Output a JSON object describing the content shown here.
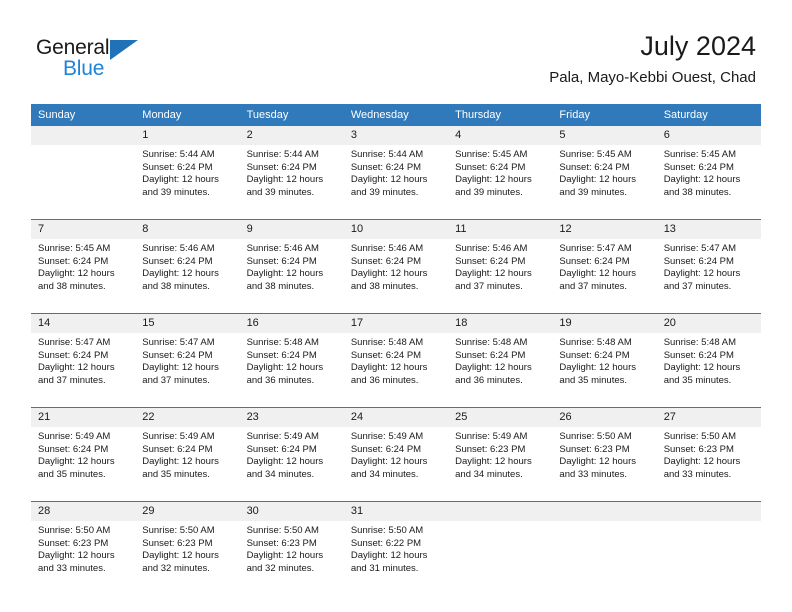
{
  "brand": {
    "name_top": "General",
    "name_bottom": "Blue",
    "accent_color": "#1f84d6",
    "triangle_color": "#1f72b8"
  },
  "header": {
    "title": "July 2024",
    "subtitle": "Pala, Mayo-Kebbi Ouest, Chad"
  },
  "calendar": {
    "header_color": "#3079bb",
    "daynum_bg": "#f0f0f0",
    "weekdays": [
      "Sunday",
      "Monday",
      "Tuesday",
      "Wednesday",
      "Thursday",
      "Friday",
      "Saturday"
    ],
    "weeks": [
      [
        {
          "day": "",
          "sunrise": "",
          "sunset": "",
          "daylight": "",
          "blank": true
        },
        {
          "day": "1",
          "sunrise": "Sunrise: 5:44 AM",
          "sunset": "Sunset: 6:24 PM",
          "daylight": "Daylight: 12 hours and 39 minutes."
        },
        {
          "day": "2",
          "sunrise": "Sunrise: 5:44 AM",
          "sunset": "Sunset: 6:24 PM",
          "daylight": "Daylight: 12 hours and 39 minutes."
        },
        {
          "day": "3",
          "sunrise": "Sunrise: 5:44 AM",
          "sunset": "Sunset: 6:24 PM",
          "daylight": "Daylight: 12 hours and 39 minutes."
        },
        {
          "day": "4",
          "sunrise": "Sunrise: 5:45 AM",
          "sunset": "Sunset: 6:24 PM",
          "daylight": "Daylight: 12 hours and 39 minutes."
        },
        {
          "day": "5",
          "sunrise": "Sunrise: 5:45 AM",
          "sunset": "Sunset: 6:24 PM",
          "daylight": "Daylight: 12 hours and 39 minutes."
        },
        {
          "day": "6",
          "sunrise": "Sunrise: 5:45 AM",
          "sunset": "Sunset: 6:24 PM",
          "daylight": "Daylight: 12 hours and 38 minutes."
        }
      ],
      [
        {
          "day": "7",
          "sunrise": "Sunrise: 5:45 AM",
          "sunset": "Sunset: 6:24 PM",
          "daylight": "Daylight: 12 hours and 38 minutes."
        },
        {
          "day": "8",
          "sunrise": "Sunrise: 5:46 AM",
          "sunset": "Sunset: 6:24 PM",
          "daylight": "Daylight: 12 hours and 38 minutes."
        },
        {
          "day": "9",
          "sunrise": "Sunrise: 5:46 AM",
          "sunset": "Sunset: 6:24 PM",
          "daylight": "Daylight: 12 hours and 38 minutes."
        },
        {
          "day": "10",
          "sunrise": "Sunrise: 5:46 AM",
          "sunset": "Sunset: 6:24 PM",
          "daylight": "Daylight: 12 hours and 38 minutes."
        },
        {
          "day": "11",
          "sunrise": "Sunrise: 5:46 AM",
          "sunset": "Sunset: 6:24 PM",
          "daylight": "Daylight: 12 hours and 37 minutes."
        },
        {
          "day": "12",
          "sunrise": "Sunrise: 5:47 AM",
          "sunset": "Sunset: 6:24 PM",
          "daylight": "Daylight: 12 hours and 37 minutes."
        },
        {
          "day": "13",
          "sunrise": "Sunrise: 5:47 AM",
          "sunset": "Sunset: 6:24 PM",
          "daylight": "Daylight: 12 hours and 37 minutes."
        }
      ],
      [
        {
          "day": "14",
          "sunrise": "Sunrise: 5:47 AM",
          "sunset": "Sunset: 6:24 PM",
          "daylight": "Daylight: 12 hours and 37 minutes."
        },
        {
          "day": "15",
          "sunrise": "Sunrise: 5:47 AM",
          "sunset": "Sunset: 6:24 PM",
          "daylight": "Daylight: 12 hours and 37 minutes."
        },
        {
          "day": "16",
          "sunrise": "Sunrise: 5:48 AM",
          "sunset": "Sunset: 6:24 PM",
          "daylight": "Daylight: 12 hours and 36 minutes."
        },
        {
          "day": "17",
          "sunrise": "Sunrise: 5:48 AM",
          "sunset": "Sunset: 6:24 PM",
          "daylight": "Daylight: 12 hours and 36 minutes."
        },
        {
          "day": "18",
          "sunrise": "Sunrise: 5:48 AM",
          "sunset": "Sunset: 6:24 PM",
          "daylight": "Daylight: 12 hours and 36 minutes."
        },
        {
          "day": "19",
          "sunrise": "Sunrise: 5:48 AM",
          "sunset": "Sunset: 6:24 PM",
          "daylight": "Daylight: 12 hours and 35 minutes."
        },
        {
          "day": "20",
          "sunrise": "Sunrise: 5:48 AM",
          "sunset": "Sunset: 6:24 PM",
          "daylight": "Daylight: 12 hours and 35 minutes."
        }
      ],
      [
        {
          "day": "21",
          "sunrise": "Sunrise: 5:49 AM",
          "sunset": "Sunset: 6:24 PM",
          "daylight": "Daylight: 12 hours and 35 minutes."
        },
        {
          "day": "22",
          "sunrise": "Sunrise: 5:49 AM",
          "sunset": "Sunset: 6:24 PM",
          "daylight": "Daylight: 12 hours and 35 minutes."
        },
        {
          "day": "23",
          "sunrise": "Sunrise: 5:49 AM",
          "sunset": "Sunset: 6:24 PM",
          "daylight": "Daylight: 12 hours and 34 minutes."
        },
        {
          "day": "24",
          "sunrise": "Sunrise: 5:49 AM",
          "sunset": "Sunset: 6:24 PM",
          "daylight": "Daylight: 12 hours and 34 minutes."
        },
        {
          "day": "25",
          "sunrise": "Sunrise: 5:49 AM",
          "sunset": "Sunset: 6:23 PM",
          "daylight": "Daylight: 12 hours and 34 minutes."
        },
        {
          "day": "26",
          "sunrise": "Sunrise: 5:50 AM",
          "sunset": "Sunset: 6:23 PM",
          "daylight": "Daylight: 12 hours and 33 minutes."
        },
        {
          "day": "27",
          "sunrise": "Sunrise: 5:50 AM",
          "sunset": "Sunset: 6:23 PM",
          "daylight": "Daylight: 12 hours and 33 minutes."
        }
      ],
      [
        {
          "day": "28",
          "sunrise": "Sunrise: 5:50 AM",
          "sunset": "Sunset: 6:23 PM",
          "daylight": "Daylight: 12 hours and 33 minutes."
        },
        {
          "day": "29",
          "sunrise": "Sunrise: 5:50 AM",
          "sunset": "Sunset: 6:23 PM",
          "daylight": "Daylight: 12 hours and 32 minutes."
        },
        {
          "day": "30",
          "sunrise": "Sunrise: 5:50 AM",
          "sunset": "Sunset: 6:23 PM",
          "daylight": "Daylight: 12 hours and 32 minutes."
        },
        {
          "day": "31",
          "sunrise": "Sunrise: 5:50 AM",
          "sunset": "Sunset: 6:22 PM",
          "daylight": "Daylight: 12 hours and 31 minutes."
        },
        {
          "day": "",
          "sunrise": "",
          "sunset": "",
          "daylight": "",
          "blank": true
        },
        {
          "day": "",
          "sunrise": "",
          "sunset": "",
          "daylight": "",
          "blank": true
        },
        {
          "day": "",
          "sunrise": "",
          "sunset": "",
          "daylight": "",
          "blank": true
        }
      ]
    ]
  }
}
